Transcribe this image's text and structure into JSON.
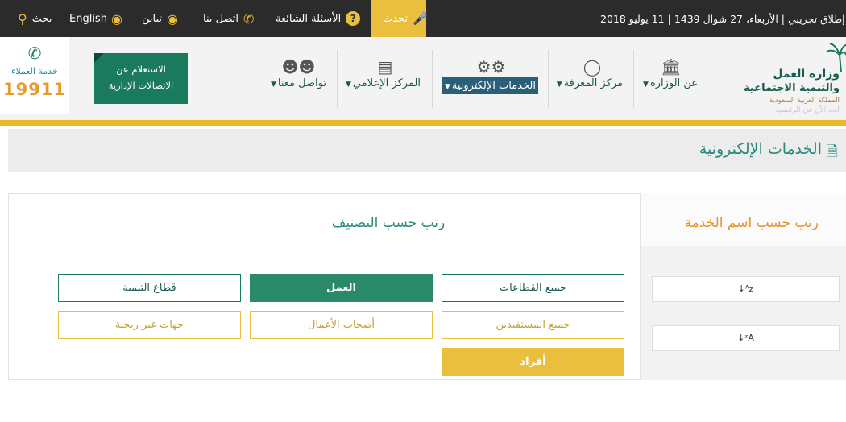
{
  "topbar": {
    "launch_date": "إطلاق تجريبي | الأربعاء، 27 شوال 1439 | 11 يوليو 2018",
    "talk": "تحدث",
    "faq": "الأسئلة الشائعة",
    "contact": "اتصل بنا",
    "contrast": "تباين",
    "english": "English",
    "search": "بحث"
  },
  "customer_service": {
    "label": "خدمة العملاء",
    "number": "19911"
  },
  "inquiry": {
    "line1": "الاستعلام عن",
    "line2": "الاتصالات الإدارية"
  },
  "nav": {
    "items": [
      {
        "label": "عن الوزارة",
        "icon": "bank-icon"
      },
      {
        "label": "مركز المعرفة",
        "icon": "lightbulb-icon"
      },
      {
        "label": "الخدمات الإلكترونية",
        "icon": "gears-icon"
      },
      {
        "label": "المركز الإعلامي",
        "icon": "newspaper-icon"
      },
      {
        "label": "تواصل معنا",
        "icon": "people-icon"
      }
    ]
  },
  "logo": {
    "line1": "وزارة العمل",
    "line2": "والتنمية الاجتماعية",
    "line3": "المملكة العربية السعودية",
    "line4": "أنت الآن في الرئيسية"
  },
  "page": {
    "title": "الخدمات الإلكترونية"
  },
  "filters": {
    "by_name_header": "رتب حسب اسم الخدمة",
    "by_category_header": "رتب حسب التصنيف",
    "sort_az": "↓ᴬz",
    "sort_za": "↓ᶻA",
    "sectors": {
      "all": "جميع القطاعات",
      "labor": "العمل",
      "development": "قطاع التنمية"
    },
    "beneficiaries": {
      "all": "جميع المستفيدين",
      "business": "أصحاب الأعمال",
      "nonprofit": "جهات غير ربحية",
      "individuals": "أفراد"
    }
  },
  "colors": {
    "green": "#1a7a5e",
    "yellow": "#eabf3d",
    "teal": "#2a8a7a",
    "orange": "#e8902a",
    "topbar": "#2b2b2b"
  }
}
